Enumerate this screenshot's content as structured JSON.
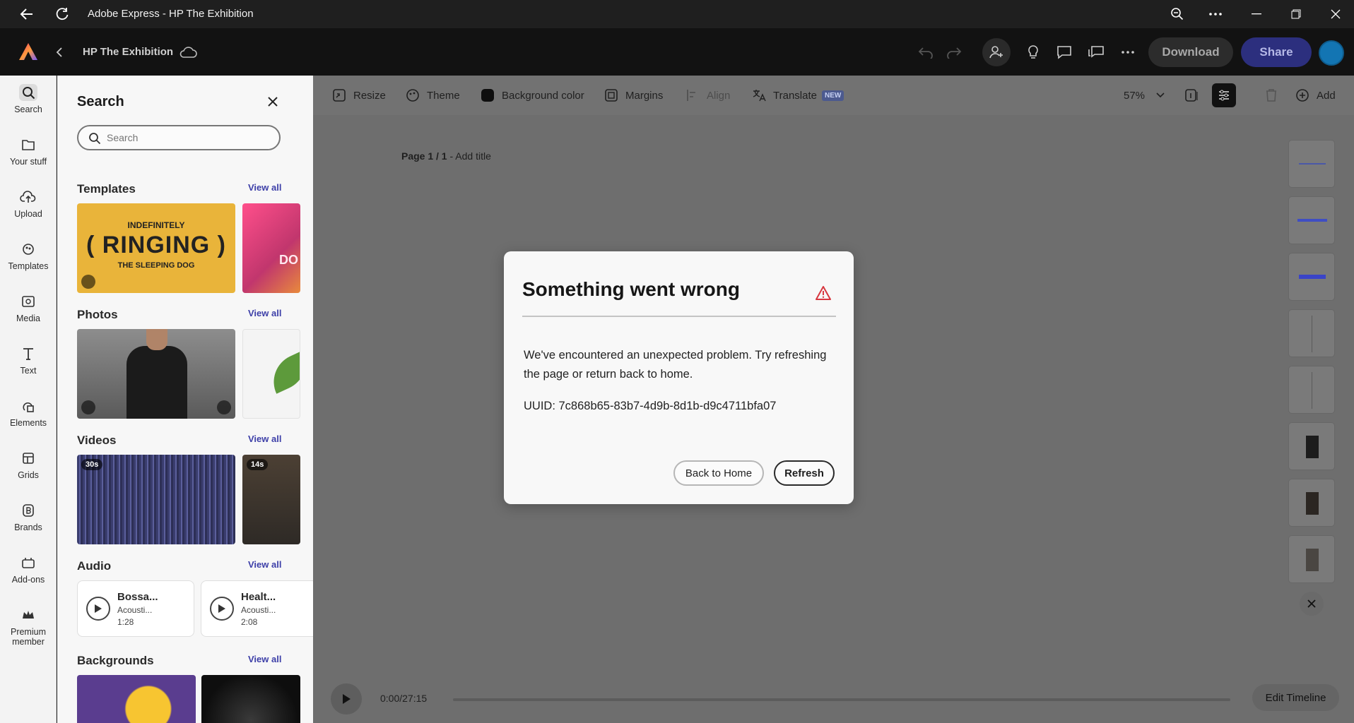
{
  "window": {
    "title": "Adobe Express - HP The Exhibition",
    "back_icon": "arrow-left-icon",
    "refresh_icon": "refresh-icon",
    "zoom_icon": "zoom-icon",
    "more_icon": "more-icon",
    "minimize_icon": "minimize-icon",
    "maximize_icon": "restore-icon",
    "close_icon": "close-icon"
  },
  "header": {
    "doc_title": "HP The Exhibition",
    "download_label": "Download",
    "share_label": "Share",
    "colors": {
      "share_bg": "#2c2f7e",
      "download_bg": "#2c2c2c"
    }
  },
  "rail": {
    "items": [
      {
        "label": "Search",
        "icon": "search-icon"
      },
      {
        "label": "Your stuff",
        "icon": "folder-icon"
      },
      {
        "label": "Upload",
        "icon": "upload-icon"
      },
      {
        "label": "Templates",
        "icon": "templates-icon"
      },
      {
        "label": "Media",
        "icon": "media-icon"
      },
      {
        "label": "Text",
        "icon": "text-icon"
      },
      {
        "label": "Elements",
        "icon": "elements-icon"
      },
      {
        "label": "Grids",
        "icon": "grids-icon"
      },
      {
        "label": "Brands",
        "icon": "brands-icon"
      },
      {
        "label": "Add-ons",
        "icon": "addons-icon"
      },
      {
        "label": "Premium",
        "label2": "member",
        "icon": "crown-icon"
      }
    ]
  },
  "panel": {
    "title": "Search",
    "search_placeholder": "Search",
    "sections": {
      "templates": {
        "title": "Templates",
        "view_all": "View all",
        "card1": {
          "line1": "INDEFINITELY",
          "line2": "( RINGING )",
          "line3": "THE SLEEPING DOG"
        },
        "card2": {
          "text": "DO"
        }
      },
      "photos": {
        "title": "Photos",
        "view_all": "View all"
      },
      "videos": {
        "title": "Videos",
        "view_all": "View all",
        "badge1": "30s",
        "badge2": "14s"
      },
      "audio": {
        "title": "Audio",
        "view_all": "View all",
        "tracks": [
          {
            "title": "Bossa...",
            "sub": "Acousti...",
            "dur": "1:28"
          },
          {
            "title": "Healt...",
            "sub": "Acousti...",
            "dur": "2:08"
          }
        ]
      },
      "backgrounds": {
        "title": "Backgrounds",
        "view_all": "View all"
      }
    }
  },
  "toolbar": {
    "resize": "Resize",
    "theme": "Theme",
    "background_color": "Background color",
    "margins": "Margins",
    "align": "Align",
    "translate": "Translate",
    "new_badge": "NEW",
    "zoom": "57%",
    "add": "Add"
  },
  "canvas": {
    "page_label": "Page 1 / 1",
    "add_title": "Add title"
  },
  "timeline": {
    "time": "0:00/27:15",
    "edit_label": "Edit Timeline"
  },
  "modal": {
    "title": "Something went wrong",
    "body": "We've encountered an unexpected problem. Try refreshing the page or return back to home.",
    "uuid": "UUID: 7c868b65-83b7-4d9b-8d1b-d9c4711bfa07",
    "back_home": "Back to Home",
    "refresh": "Refresh",
    "warn_color": "#d7373f"
  }
}
